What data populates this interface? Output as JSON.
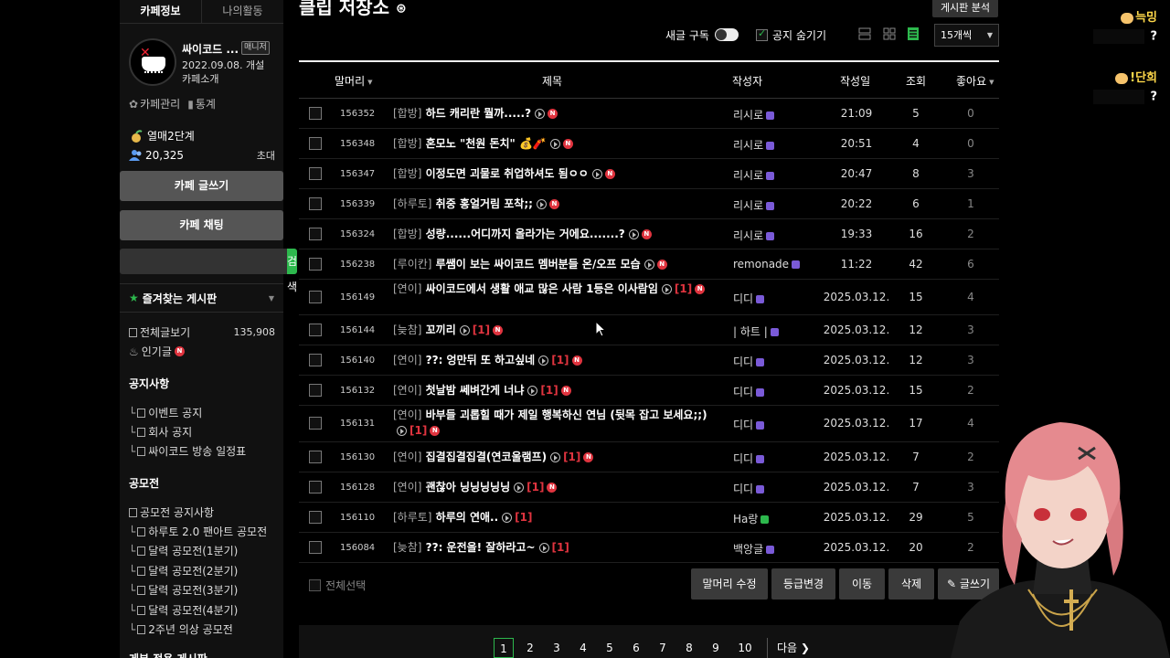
{
  "sidebar": {
    "tabs": [
      "카페정보",
      "나의활동"
    ],
    "cafe_name": "싸이코드 ...",
    "manager_badge": "매니저",
    "cafe_date": "2022.09.08. 개설",
    "cafe_intro": "카페소개",
    "links": [
      "카페관리",
      "통계"
    ],
    "level": "열매2단계",
    "member_count": "20,325",
    "invite": "초대",
    "write_button": "카페 글쓰기",
    "chat_button": "카페 채팅",
    "search_button": "검색",
    "search_value": "",
    "fav_title": "즐겨찾는 게시판",
    "all_posts": "전체글보기",
    "all_posts_count": "135,908",
    "popular": "인기글",
    "new_badge": "N",
    "sections": [
      {
        "title": "공지사항",
        "items": [
          "이벤트 공지",
          "회사 공지",
          "싸이코드 방송 일정표"
        ]
      },
      {
        "title": "공모전",
        "items": [
          "공모전 공지사항",
          "하루토 2.0 팬아트 공모전",
          "달력 공모전(1분기)",
          "달력 공모전(2분기)",
          "달력 공모전(3분기)",
          "달력 공모전(4분기)",
          "2주년 의상 공모전"
        ]
      }
    ],
    "cut_section": "게부 전용 게시판"
  },
  "main": {
    "title": "클립 저장소",
    "board_info_button": "게시판 분석",
    "new_subscribe": "새글 구독",
    "hide_notice": "공지 숨기기",
    "per_page": "15개씩",
    "headers": {
      "prefix": "말머리",
      "title": "제목",
      "author": "작성자",
      "date": "작성일",
      "views": "조회",
      "likes": "좋아요"
    },
    "rows": [
      {
        "id": "156352",
        "head": "[합방]",
        "title": "하드 캐리란 뭘까.....?",
        "comments": "",
        "new": true,
        "author": "리시로",
        "lv": "p",
        "date": "21:09",
        "views": "5",
        "likes": "0"
      },
      {
        "id": "156348",
        "head": "[합방]",
        "title": "혼모노 \"천원 돈치\" 💰🧨",
        "comments": "",
        "new": true,
        "author": "리시로",
        "lv": "p",
        "date": "20:51",
        "views": "4",
        "likes": "0"
      },
      {
        "id": "156347",
        "head": "[합방]",
        "title": "이정도면 괴물로 취업하셔도 됨ㅇㅇ",
        "comments": "",
        "new": true,
        "author": "리시로",
        "lv": "p",
        "date": "20:47",
        "views": "8",
        "likes": "3"
      },
      {
        "id": "156339",
        "head": "[하루토]",
        "title": "취중 홍얼거림 포착;;",
        "comments": "",
        "new": true,
        "author": "리시로",
        "lv": "p",
        "date": "20:22",
        "views": "6",
        "likes": "1"
      },
      {
        "id": "156324",
        "head": "[합방]",
        "title": "성량......어디까지 올라가는 거에요.......?",
        "comments": "",
        "new": true,
        "author": "리시로",
        "lv": "p",
        "date": "19:33",
        "views": "16",
        "likes": "2"
      },
      {
        "id": "156238",
        "head": "[루이칸]",
        "title": "루쌤이 보는 싸이코드 멤버분들 온/오프 모습",
        "comments": "",
        "new": true,
        "author": "remonade",
        "lv": "p",
        "date": "11:22",
        "views": "42",
        "likes": "6"
      },
      {
        "id": "156149",
        "head": "[연이]",
        "title": "싸이코드에서 생활 애교 많은 사람 1등은 이사람임",
        "comments": "[1]",
        "new": true,
        "author": "디디",
        "lv": "p",
        "date": "2025.03.12.",
        "views": "15",
        "likes": "4"
      },
      {
        "id": "156144",
        "head": "[늦참]",
        "title": "꼬끼리",
        "comments": "[1]",
        "new": true,
        "author": "| 하트 |",
        "lv": "p",
        "date": "2025.03.12.",
        "views": "12",
        "likes": "3"
      },
      {
        "id": "156140",
        "head": "[연이]",
        "title": "??: 엉만뒤 또 하고싶네",
        "comments": "[1]",
        "new": true,
        "author": "디디",
        "lv": "p",
        "date": "2025.03.12.",
        "views": "12",
        "likes": "3"
      },
      {
        "id": "156132",
        "head": "[연이]",
        "title": "첫날밤 쎄벼간게 너냐",
        "comments": "[1]",
        "new": true,
        "author": "디디",
        "lv": "p",
        "date": "2025.03.12.",
        "views": "15",
        "likes": "2"
      },
      {
        "id": "156131",
        "head": "[연이]",
        "title": "바부들 괴롭힐 때가 제일 행복하신 연님 (뒷목 잡고 보세요;;)",
        "comments": "[1]",
        "new": true,
        "author": "디디",
        "lv": "p",
        "date": "2025.03.12.",
        "views": "17",
        "likes": "4"
      },
      {
        "id": "156130",
        "head": "[연이]",
        "title": "집결집결집결(연코울램프)",
        "comments": "[1]",
        "new": true,
        "author": "디디",
        "lv": "p",
        "date": "2025.03.12.",
        "views": "7",
        "likes": "2"
      },
      {
        "id": "156128",
        "head": "[연이]",
        "title": "괜찮아 닝닝닝닝닝",
        "comments": "[1]",
        "new": true,
        "author": "디디",
        "lv": "p",
        "date": "2025.03.12.",
        "views": "7",
        "likes": "3"
      },
      {
        "id": "156110",
        "head": "[하루토]",
        "title": "하루의 연애..",
        "comments": "[1]",
        "new": false,
        "author": "Ha랑",
        "lv": "g",
        "date": "2025.03.12.",
        "views": "29",
        "likes": "5"
      },
      {
        "id": "156084",
        "head": "[늦참]",
        "title": "??: 운전을! 잘하라고~",
        "comments": "[1]",
        "new": false,
        "author": "백앙글",
        "lv": "p",
        "date": "2025.03.12.",
        "views": "20",
        "likes": "2"
      }
    ],
    "select_all": "전체선택",
    "actions": [
      "말머리 수정",
      "등급변경",
      "이동",
      "삭제",
      "글쓰기"
    ],
    "pages": [
      "1",
      "2",
      "3",
      "4",
      "5",
      "6",
      "7",
      "8",
      "9",
      "10"
    ],
    "current_page": "1",
    "next": "다음"
  },
  "chat": [
    {
      "name": "늑밍",
      "msg": "?"
    },
    {
      "name": "!단희",
      "msg": "?"
    }
  ]
}
